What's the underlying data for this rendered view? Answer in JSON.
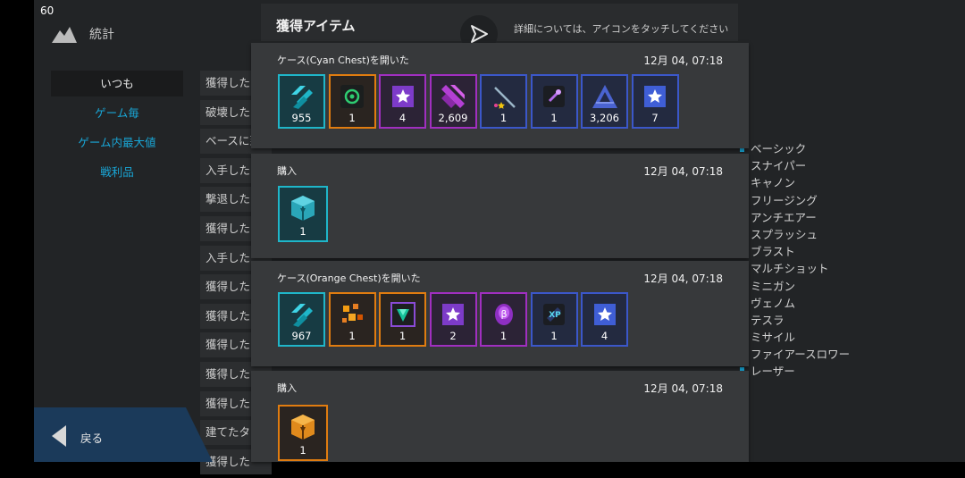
{
  "fps": "60",
  "stats": {
    "title": "統計",
    "menu": [
      "いつも",
      "ゲーム毎",
      "ゲーム内最大値",
      "戦利品"
    ],
    "rows": [
      "獲得した",
      "破壊した",
      "ベースに到",
      "入手した",
      "撃退した",
      "獲得した",
      "入手した",
      "獲得した",
      "獲得した",
      "獲得した",
      "獲得した",
      "獲得した",
      "建てたタ",
      "獲得した"
    ],
    "right_list": [
      "ベーシック",
      "スナイパー",
      "キャノン",
      "フリージング",
      "アンチエアー",
      "スプラッシュ",
      "ブラスト",
      "マルチショット",
      "ミニガン",
      "ヴェノム",
      "テスラ",
      "ミサイル",
      "ファイアースロワー",
      "レーザー"
    ]
  },
  "back_label": "戻る",
  "modal": {
    "title": "獲得アイテム",
    "hint": "詳細については、アイコンをタッチしてください",
    "cards": [
      {
        "title": "ケース(Cyan Chest)を開いた",
        "time": "12月 04, 07:18",
        "items": [
          {
            "icon": "cyan-shard-icon",
            "rarity": "cyan",
            "count": "955"
          },
          {
            "icon": "green-swirl-icon",
            "rarity": "orange",
            "count": "1"
          },
          {
            "icon": "star-scroll-icon",
            "rarity": "purple",
            "count": "4"
          },
          {
            "icon": "purple-stripes-icon",
            "rarity": "purple",
            "count": "2,609"
          },
          {
            "icon": "staff-icon",
            "rarity": "blue",
            "count": "1"
          },
          {
            "icon": "potion-icon",
            "rarity": "blue",
            "count": "1"
          },
          {
            "icon": "triangle-icon",
            "rarity": "blue",
            "count": "3,206"
          },
          {
            "icon": "star-scroll-icon",
            "rarity": "blue",
            "count": "7"
          }
        ]
      },
      {
        "title": "購入",
        "time": "12月 04, 07:18",
        "items": [
          {
            "icon": "cyan-chest-icon",
            "rarity": "cyan",
            "count": "1"
          }
        ]
      },
      {
        "title": "ケース(Orange Chest)を開いた",
        "time": "12月 04, 07:18",
        "items": [
          {
            "icon": "cyan-shard-icon",
            "rarity": "cyan",
            "count": "967"
          },
          {
            "icon": "orange-cubes-icon",
            "rarity": "orange",
            "count": "1"
          },
          {
            "icon": "gem-frame-icon",
            "rarity": "orange",
            "count": "1"
          },
          {
            "icon": "star-scroll-icon",
            "rarity": "purple",
            "count": "2"
          },
          {
            "icon": "beta-orb-icon",
            "rarity": "purple",
            "count": "1"
          },
          {
            "icon": "xp-icon",
            "rarity": "blue",
            "count": "1"
          },
          {
            "icon": "star-scroll-icon",
            "rarity": "blue",
            "count": "4"
          }
        ]
      },
      {
        "title": "購入",
        "time": "12月 04, 07:18",
        "items": [
          {
            "icon": "orange-chest-icon",
            "rarity": "orange",
            "count": "1"
          }
        ]
      }
    ]
  },
  "colors": {
    "cyan": "#1fb6c9",
    "orange": "#e07c10",
    "purple": "#a02fc0",
    "blue": "#3b57c9",
    "accent": "#19a6d6"
  }
}
